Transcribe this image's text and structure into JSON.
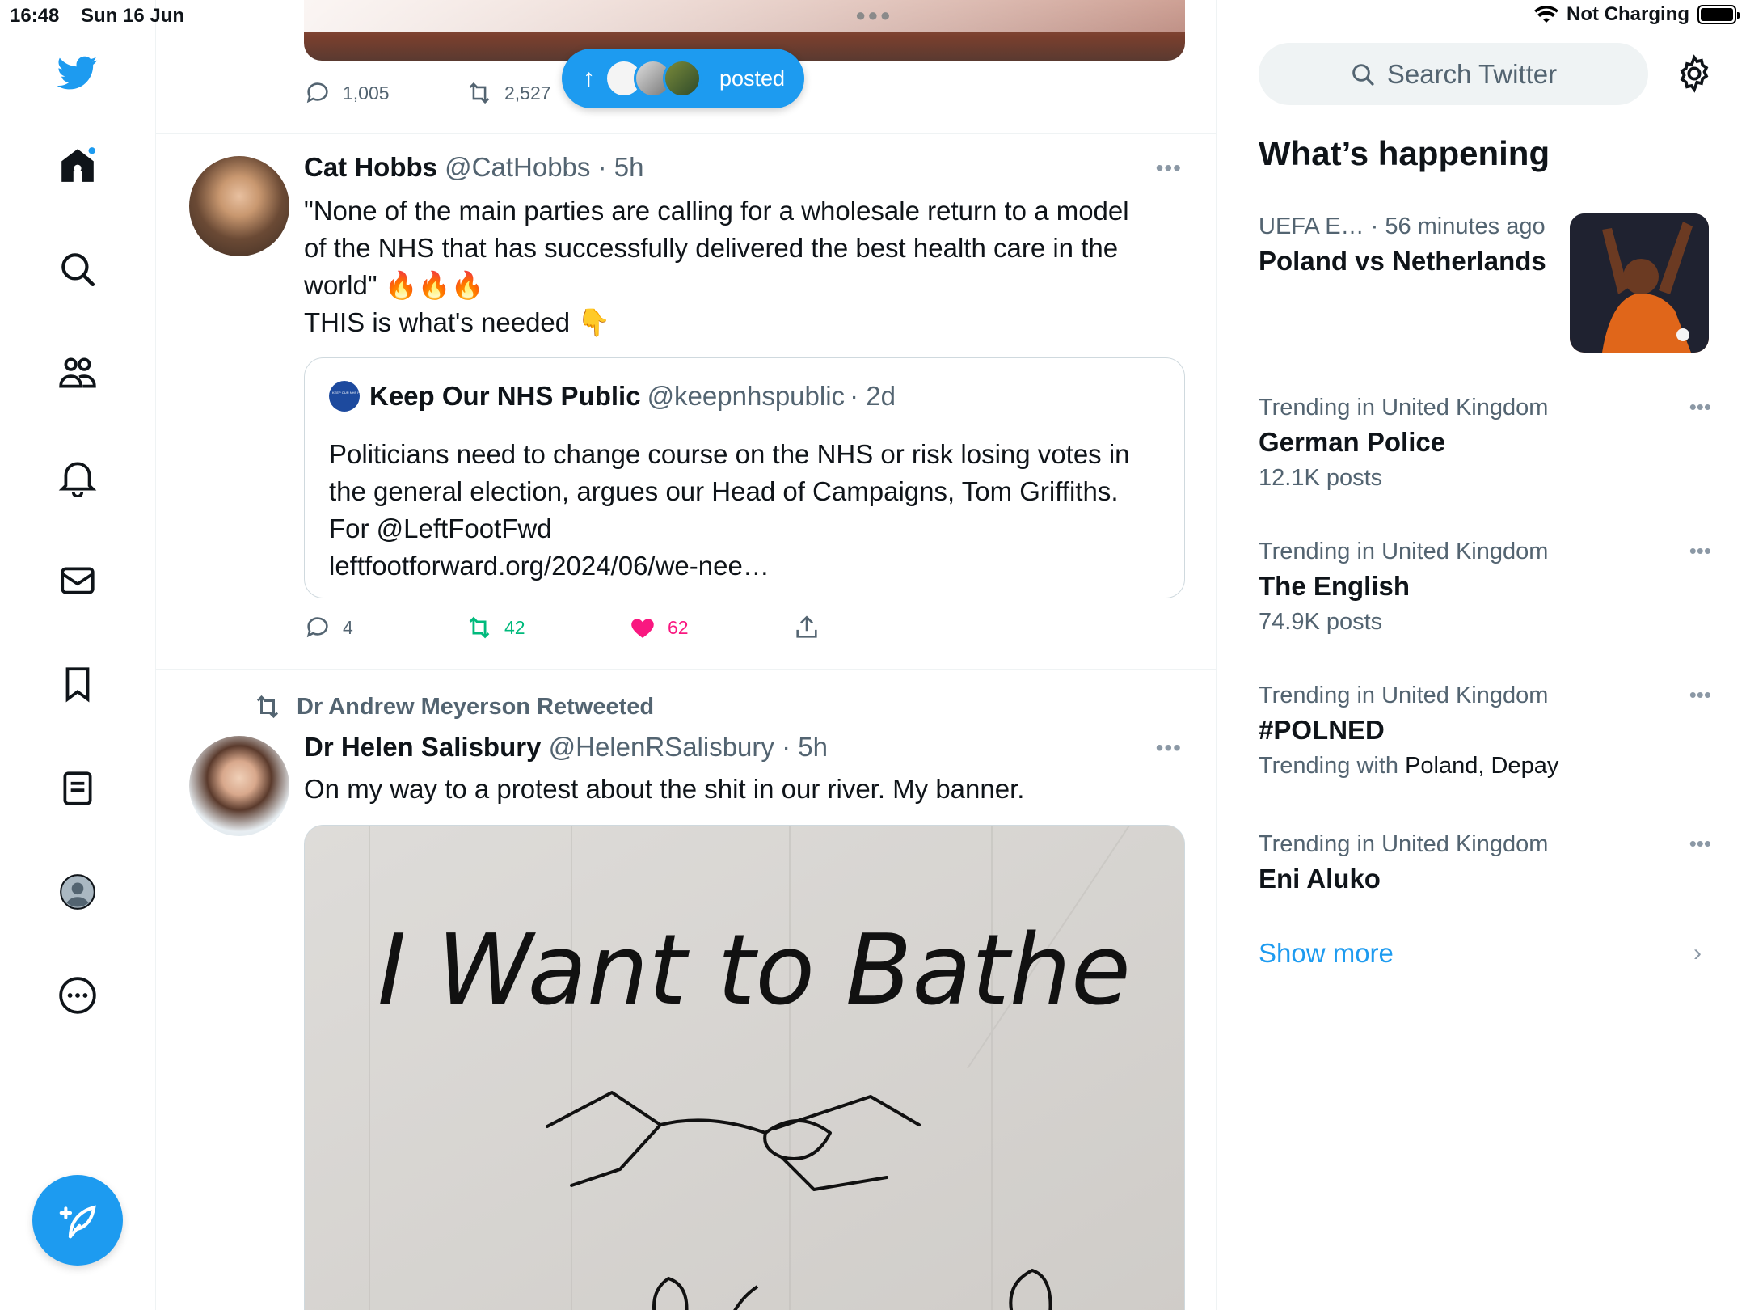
{
  "status_bar": {
    "time": "16:48",
    "date": "Sun 16 Jun",
    "charging": "Not Charging"
  },
  "nav": {
    "icons": [
      "twitter-logo-icon",
      "home-icon",
      "search-icon",
      "communities-icon",
      "notifications-icon",
      "messages-icon",
      "bookmarks-icon",
      "lists-icon",
      "profile-icon",
      "more-icon",
      "compose-icon"
    ]
  },
  "top_tweet": {
    "replies": "1,005",
    "retweets": "2,527"
  },
  "posted_pill": {
    "label": "posted"
  },
  "tweet1": {
    "name": "Cat Hobbs",
    "handle": "@CatHobbs",
    "time": "· 5h",
    "text_line1": "\"None of the main parties are calling for a wholesale return to a model",
    "text_line2": "of the NHS that has successfully delivered the best health care in the",
    "text_line3": "world\" 🔥🔥🔥",
    "text_line4": "THIS is what's needed  👇",
    "quote": {
      "name": "Keep Our NHS Public",
      "handle": "@keepnhspublic",
      "time": "· 2d",
      "line1": "Politicians need to change course on the NHS or risk losing votes in",
      "line2": "the general election, argues our Head of Campaigns, Tom Griffiths.",
      "line3": "For @LeftFootFwd",
      "line4": "leftfootforward.org/2024/06/we-nee…"
    },
    "replies": "4",
    "retweets": "42",
    "likes": "62"
  },
  "tweet2": {
    "context": "Dr Andrew Meyerson Retweeted",
    "name": "Dr Helen Salisbury",
    "handle": "@HelenRSalisbury",
    "time": "· 5h",
    "text": "On my way to a protest about the shit in our river. My banner.",
    "banner_text": "I Want to Bathe"
  },
  "right": {
    "search_placeholder": "Search Twitter",
    "heading": "What’s happening",
    "trends": [
      {
        "meta": "UEFA E… · 56 minutes ago",
        "title": "Poland vs Netherlands",
        "count": ""
      },
      {
        "meta": "Trending in United Kingdom",
        "title": "German Police",
        "count": "12.1K posts"
      },
      {
        "meta": "Trending in United Kingdom",
        "title": "The English",
        "count": "74.9K posts"
      },
      {
        "meta": "Trending in United Kingdom",
        "title": "#POLNED",
        "count_prefix": "Trending with",
        "count": "Poland, Depay"
      },
      {
        "meta": "Trending in United Kingdom",
        "title": "Eni Aluko",
        "count": ""
      }
    ],
    "show_more": "Show more"
  },
  "colors": {
    "accent": "#1d9bf0",
    "retweet_green": "#00ba7c",
    "like_pink": "#f91880",
    "secondary_text": "#536471"
  }
}
